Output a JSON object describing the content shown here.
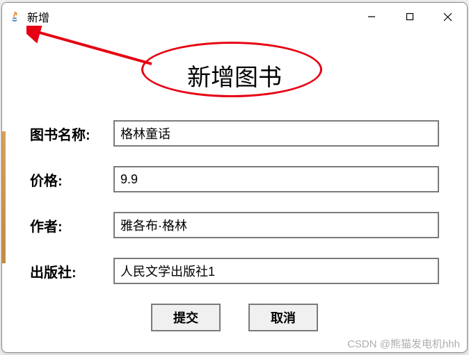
{
  "window": {
    "title": "新增"
  },
  "page": {
    "heading": "新增图书"
  },
  "form": {
    "name": {
      "label": "图书名称:",
      "value": "格林童话"
    },
    "price": {
      "label": "价格:",
      "value": "9.9"
    },
    "author": {
      "label": "作者:",
      "value": "雅各布·格林"
    },
    "publisher": {
      "label": "出版社:",
      "value": "人民文学出版社1"
    }
  },
  "buttons": {
    "submit": "提交",
    "cancel": "取消"
  },
  "watermark": "CSDN @熊猫发电机hhh"
}
